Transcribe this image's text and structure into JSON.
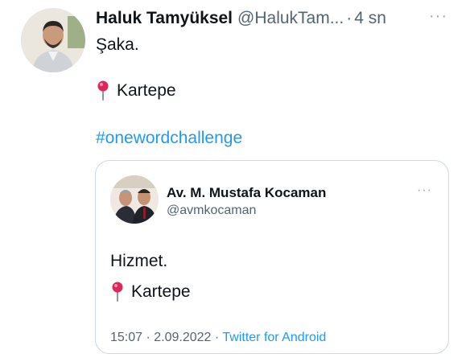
{
  "author": {
    "display_name": "Haluk Tamyüksel",
    "handle": "@HalukTam...",
    "separator": "·",
    "time": "4 sn",
    "more_label": "···"
  },
  "tweet": {
    "text_line1": "Şaka.",
    "location": "Kartepe",
    "hashtag": "#onewordchallenge"
  },
  "quoted": {
    "display_name": "Av. M. Mustafa Kocaman",
    "handle": "@avmkocaman",
    "more_label": "···",
    "text_line1": "Hizmet.",
    "location": "Kartepe",
    "timestamp": "15:07 · 2.09.2022 · ",
    "source": "Twitter for Android"
  },
  "colors": {
    "link": "#1d9bf0",
    "secondary_text": "#536471",
    "pin_red": "#e0245e"
  },
  "icons": {
    "location_pin": "round-pushpin-icon",
    "more": "more-options-icon"
  }
}
